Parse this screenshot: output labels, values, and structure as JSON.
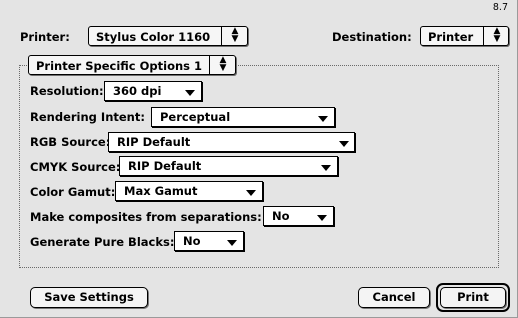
{
  "version": "8.7",
  "printer": {
    "label": "Printer:",
    "value": "Stylus Color 1160"
  },
  "destination": {
    "label": "Destination:",
    "value": "Printer"
  },
  "panel": {
    "value": "Printer Specific Options 1"
  },
  "options": {
    "resolution": {
      "label": "Resolution:",
      "value": "360 dpi"
    },
    "rendering_intent": {
      "label": "Rendering Intent:",
      "value": "Perceptual"
    },
    "rgb_source": {
      "label": "RGB Source:",
      "value": "RIP Default"
    },
    "cmyk_source": {
      "label": "CMYK Source:",
      "value": "RIP Default"
    },
    "color_gamut": {
      "label": "Color Gamut:",
      "value": "Max Gamut"
    },
    "composites": {
      "label": "Make composites from separations:",
      "value": "No"
    },
    "pure_blacks": {
      "label": "Generate Pure Blacks:",
      "value": "No"
    }
  },
  "buttons": {
    "save": "Save Settings",
    "cancel": "Cancel",
    "print": "Print"
  }
}
